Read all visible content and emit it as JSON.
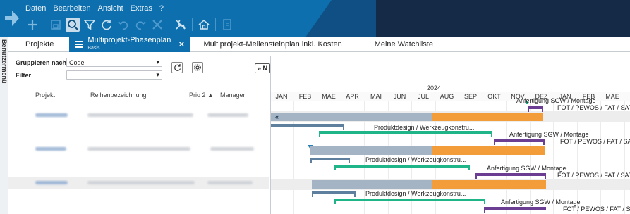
{
  "menu": {
    "items": [
      "Daten",
      "Bearbeiten",
      "Ansicht",
      "Extras",
      "?"
    ]
  },
  "toolbar": {
    "icons": [
      "plus-icon",
      "save-icon",
      "search-icon",
      "filter-icon",
      "refresh-icon",
      "undo-icon",
      "redo-icon",
      "delete-icon",
      "tools-icon",
      "home-icon",
      "export-icon"
    ]
  },
  "sidebar": {
    "label": "Benutzermenü"
  },
  "tabs": [
    {
      "label": "Projekte",
      "sub": ""
    },
    {
      "label": "Multiprojekt-Phasenplan",
      "sub": "Basis"
    },
    {
      "label": "Multiprojekt-Meilensteinplan inkl. Kosten",
      "sub": ""
    },
    {
      "label": "Meine Watchliste",
      "sub": ""
    }
  ],
  "filters": {
    "group_label": "Gruppieren nach",
    "group_value": "Code",
    "filter_label": "Filter",
    "filter_value": "",
    "nav_label": "» N"
  },
  "grid": {
    "headers": [
      "Projekt",
      "Reihenbezeichnung",
      "Prio 2 ▲",
      "Manager"
    ]
  },
  "gantt": {
    "year": "2024",
    "months": [
      "JAN",
      "FEB",
      "MAE",
      "APR",
      "MAI",
      "JUN",
      "JUL",
      "AUG",
      "SEP",
      "OKT",
      "NOV",
      "DEZ",
      "JAN",
      "FEB",
      "MAE"
    ],
    "labels": {
      "collapse": "«",
      "fab_top": "Anfertigung SGW / Montage",
      "fot_1": "FOT / PEWOS / FAT / SAT",
      "design_1": "Produktdesign / Werkzeugkonstru...",
      "fab_1": "Anfertigung SGW / Montage",
      "fot_2": "FOT / PEWOS / FAT / SAT",
      "design_2": "Produktdesign / Werkzeugkonstru...",
      "fab_2": "Anfertigung SGW / Montage",
      "fot_3": "FOT / PEWOS / FAT / SAT",
      "design_3": "Produktdesign / Werkzeugkonstru...",
      "fab_3": "Anfertigung SGW / Montage",
      "fot_4": "FOT / PEWOS / FAT / SAT"
    }
  },
  "colors": {
    "header_blue": "#0d6fae",
    "header_dark": "#142a47",
    "bar_gray": "#a4b4c4",
    "bar_orange": "#f39c3a",
    "bar_green": "#1fb589",
    "bar_purple": "#6b3d93",
    "today_red": "#e94f3a"
  }
}
